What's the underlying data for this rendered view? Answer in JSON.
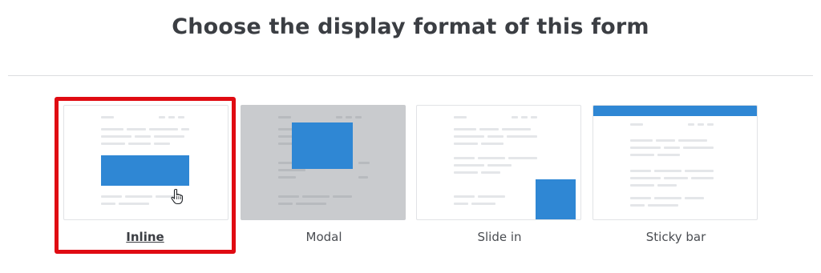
{
  "page": {
    "title": "Choose the display format of this form"
  },
  "options": [
    {
      "label": "Inline",
      "selected": true,
      "icon": "inline-form-preview-icon"
    },
    {
      "label": "Modal",
      "selected": false,
      "icon": "modal-form-preview-icon"
    },
    {
      "label": "Slide in",
      "selected": false,
      "icon": "slide-in-form-preview-icon"
    },
    {
      "label": "Sticky bar",
      "selected": false,
      "icon": "sticky-bar-form-preview-icon"
    }
  ],
  "colors": {
    "accent_blue": "#2f87d4",
    "selection_red": "#e00b12",
    "title_text": "#3b3e43",
    "modal_overlay": "#c9cbce"
  },
  "cursor": "hand-pointer-icon"
}
